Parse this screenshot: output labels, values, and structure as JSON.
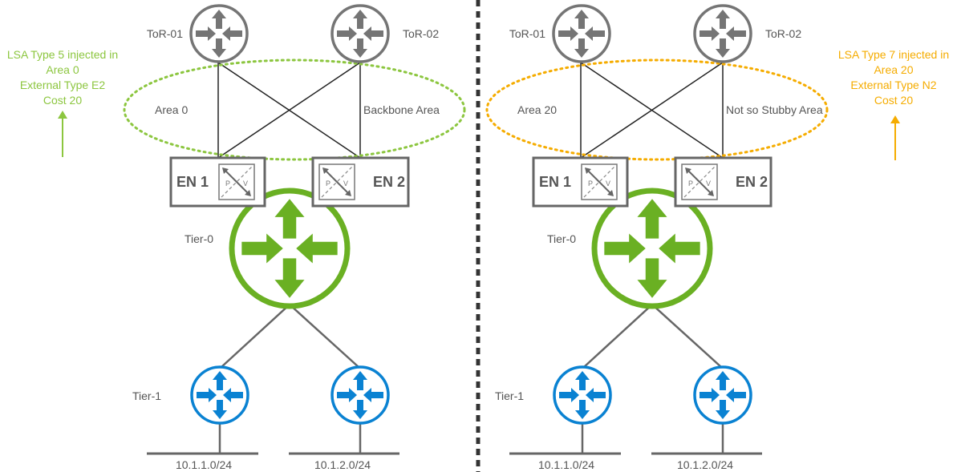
{
  "colors": {
    "area0": "#8cc63f",
    "area20": "#f5ac00",
    "tier0": "#6ab023",
    "tier1": "#0a82d2",
    "tor": "#757575"
  },
  "left": {
    "tor1": "ToR-01",
    "tor2": "ToR-02",
    "area_label": "Area 0",
    "area_type": "Backbone Area",
    "en1": "EN 1",
    "en2": "EN 2",
    "icon_p": "P",
    "icon_v": "V",
    "tier0": "Tier-0",
    "tier1": "Tier-1",
    "subnet1": "10.1.1.0/24",
    "subnet2": "10.1.2.0/24",
    "note": [
      "LSA Type 5 injected in",
      "Area 0",
      "External Type E2",
      "Cost 20"
    ]
  },
  "right": {
    "tor1": "ToR-01",
    "tor2": "ToR-02",
    "area_label": "Area 20",
    "area_type": "Not so Stubby Area",
    "en1": "EN 1",
    "en2": "EN 2",
    "icon_p": "P",
    "icon_v": "V",
    "tier0": "Tier-0",
    "tier1": "Tier-1",
    "subnet1": "10.1.1.0/24",
    "subnet2": "10.1.2.0/24",
    "note": [
      "LSA Type 7 injected in",
      "Area 20",
      "External Type N2",
      "Cost 20"
    ]
  }
}
